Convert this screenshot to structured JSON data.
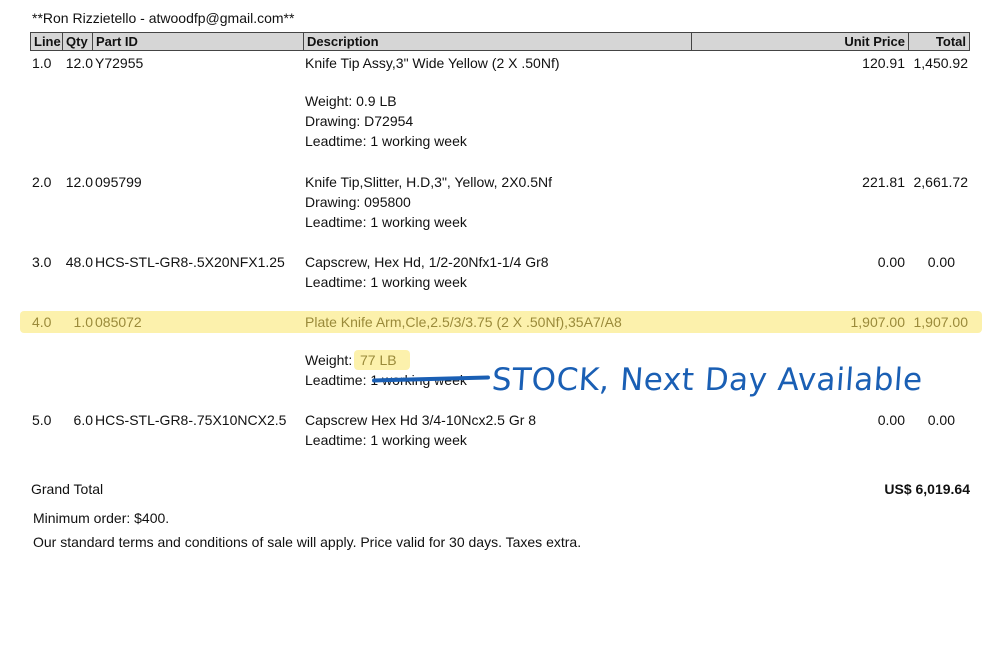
{
  "header_line": "**Ron Rizzietello - atwoodfp@gmail.com**",
  "columns": {
    "line": "Line",
    "qty": "Qty",
    "part_id": "Part ID",
    "description": "Description",
    "unit_price": "Unit Price",
    "total": "Total"
  },
  "rows": [
    {
      "line": "1.0",
      "qty": "12.0",
      "part_id": "Y72955",
      "description": "Knife Tip Assy,3\" Wide Yellow (2 X .50Nf)",
      "unit_price": "120.91",
      "total": "1,450.92",
      "details": [
        "Weight: 0.9 LB",
        "Drawing: D72954",
        "Leadtime: 1 working week"
      ]
    },
    {
      "line": "2.0",
      "qty": "12.0",
      "part_id": "095799",
      "description": "Knife Tip,Slitter, H.D,3\", Yellow, 2X0.5Nf",
      "unit_price": "221.81",
      "total": "2,661.72",
      "details": [
        "Drawing: 095800",
        "Leadtime: 1 working week"
      ]
    },
    {
      "line": "3.0",
      "qty": "48.0",
      "part_id": "HCS-STL-GR8-.5X20NFX1.25",
      "description": "Capscrew, Hex Hd, 1/2-20Nfx1-1/4 Gr8",
      "unit_price": "0.00",
      "total": "0.00",
      "details": [
        "Leadtime: 1 working week"
      ]
    },
    {
      "line": "4.0",
      "qty": "1.0",
      "part_id": "085072",
      "description": "Plate Knife Arm,Cle,2.5/3/3.75 (2 X .50Nf),35A7/A8",
      "unit_price": "1,907.00",
      "total": "1,907.00",
      "details": [
        "Weight: ",
        "77 LB",
        "Leadtime: 1 working week"
      ]
    },
    {
      "line": "5.0",
      "qty": "6.0",
      "part_id": "HCS-STL-GR8-.75X10NCX2.5",
      "description": "Capscrew Hex Hd 3/4-10Ncx2.5 Gr 8",
      "unit_price": "0.00",
      "total": "0.00",
      "details": [
        "Leadtime: 1 working week"
      ]
    }
  ],
  "grand_total": {
    "label": "Grand Total",
    "value": "US$ 6,019.64"
  },
  "notes": [
    "Minimum order: $400.",
    "Our standard terms and conditions of sale will apply. Price valid for 30 days. Taxes extra."
  ],
  "annotation": "STOCK, Next Day Available",
  "colors": {
    "highlight": "#fcef9e",
    "ink": "#1a5fb4",
    "header_bg": "#d6d6d6"
  }
}
